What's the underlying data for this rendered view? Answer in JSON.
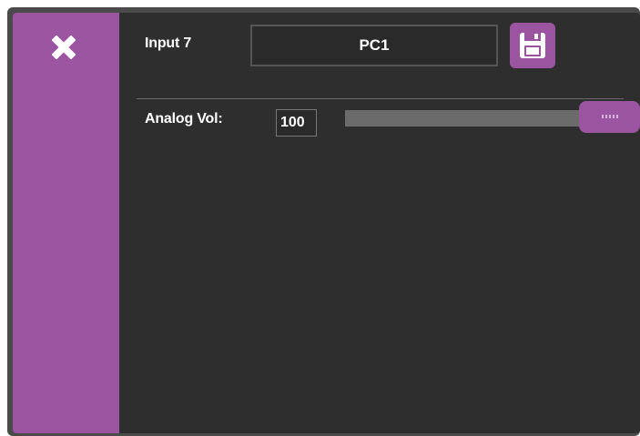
{
  "header": {
    "title": "Input 7",
    "name_value": "PC1"
  },
  "volume": {
    "label": "Analog Vol:",
    "value": "100",
    "level_percent": 100
  },
  "icons": {
    "close": "close-icon",
    "save": "floppy-disk-icon"
  },
  "colors": {
    "accent": "#9b55a0",
    "panel_bg": "#2e2e2e",
    "track": "#6b6b6b"
  }
}
